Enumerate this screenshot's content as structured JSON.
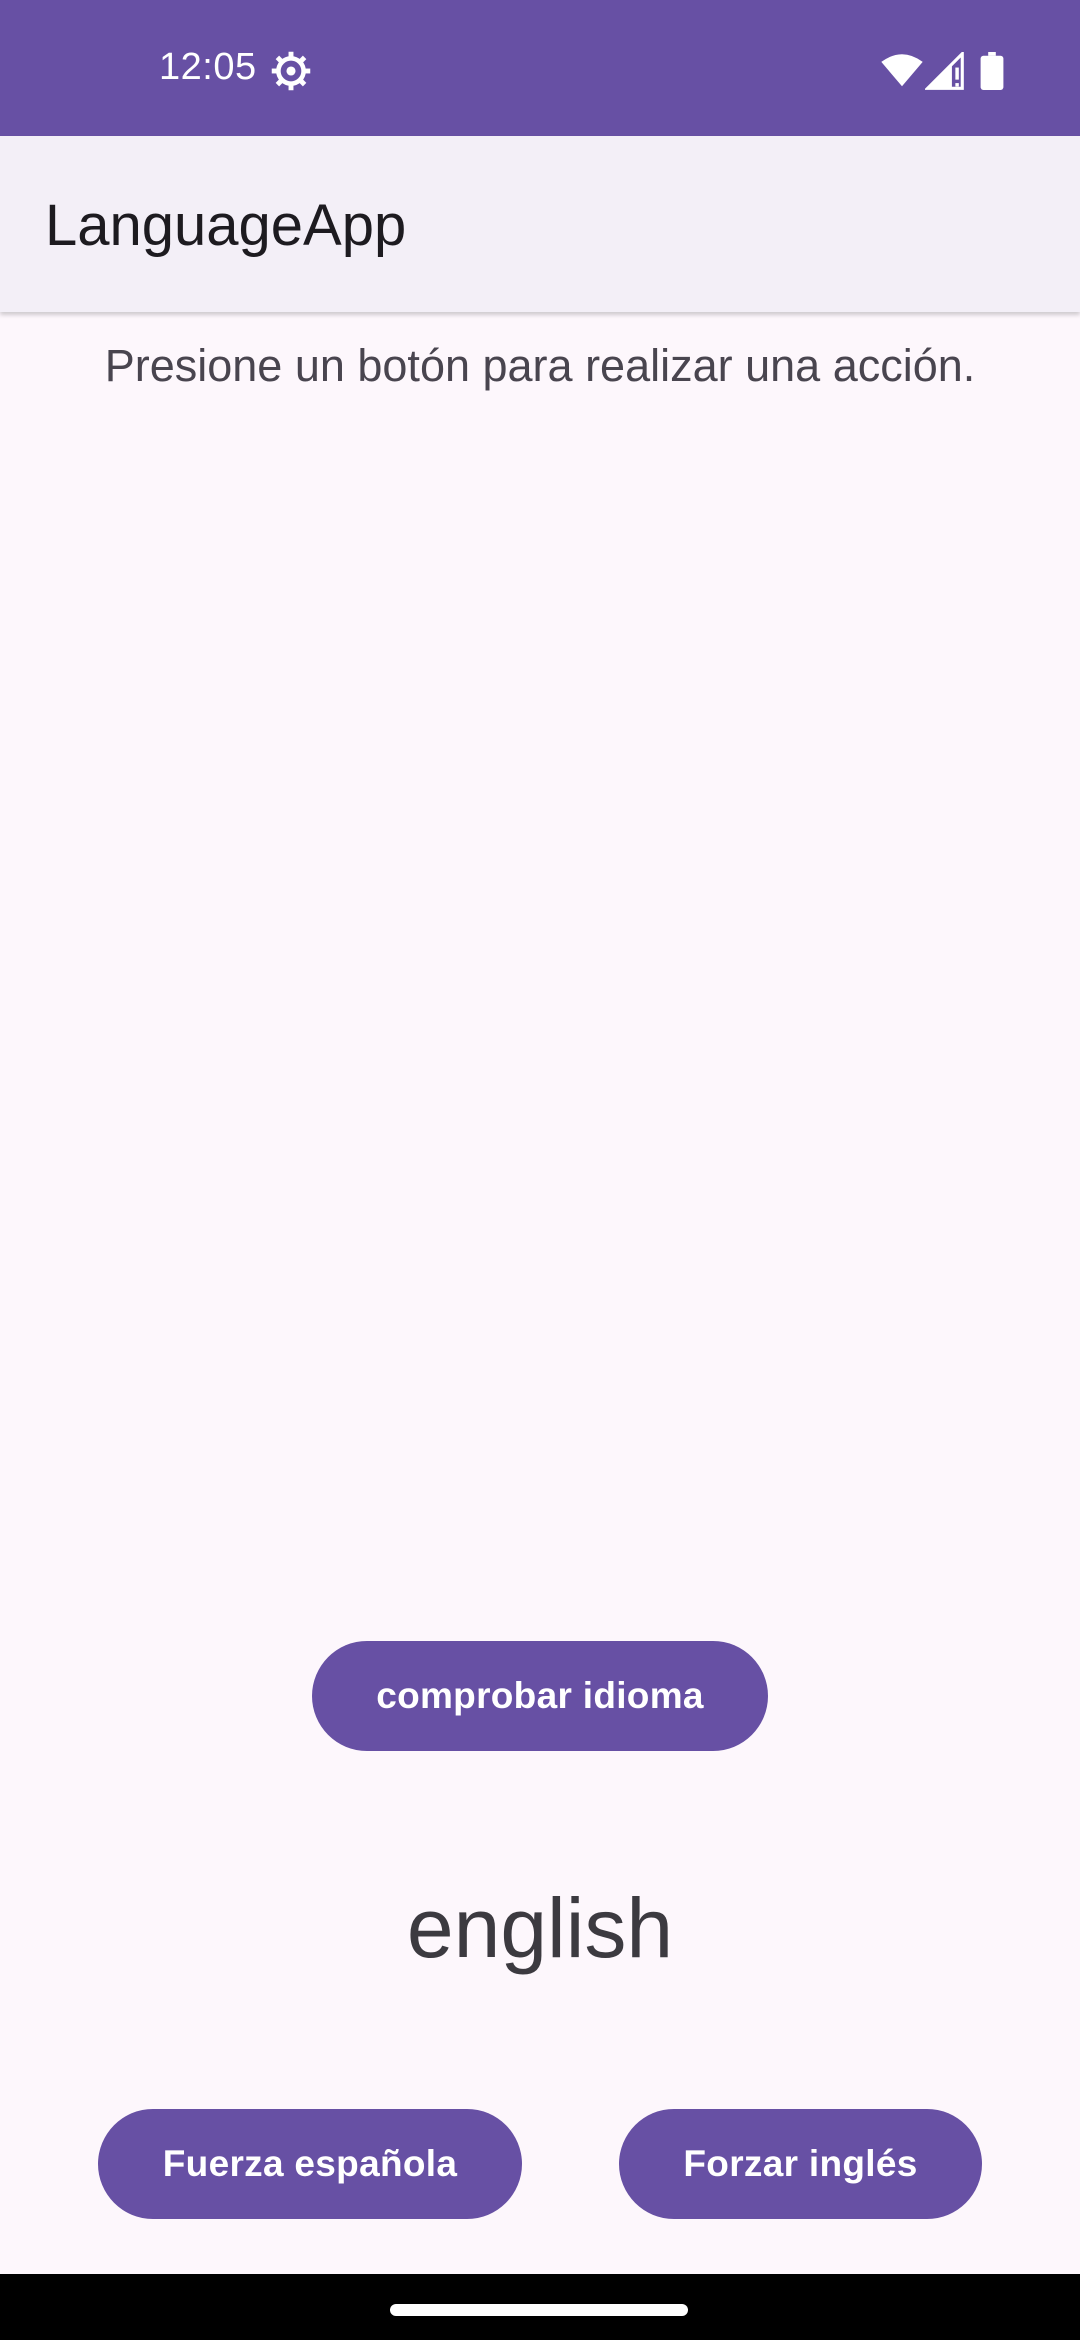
{
  "status_bar": {
    "time": "12:05",
    "icons": [
      "gear-icon",
      "wifi-icon",
      "signal-icon",
      "battery-icon"
    ],
    "color": "#6750a4"
  },
  "app_bar": {
    "title": "LanguageApp",
    "background": "#f3eff7"
  },
  "main": {
    "instruction": "Presione un botón para realizar una acción.",
    "check_language_button": "comprobar idioma",
    "detected_language": "english",
    "force_spanish_button": "Fuerza española",
    "force_english_button": "Forzar inglés",
    "accent_color": "#6750a4"
  },
  "navigation_bar": {
    "handle": "home-handle"
  }
}
